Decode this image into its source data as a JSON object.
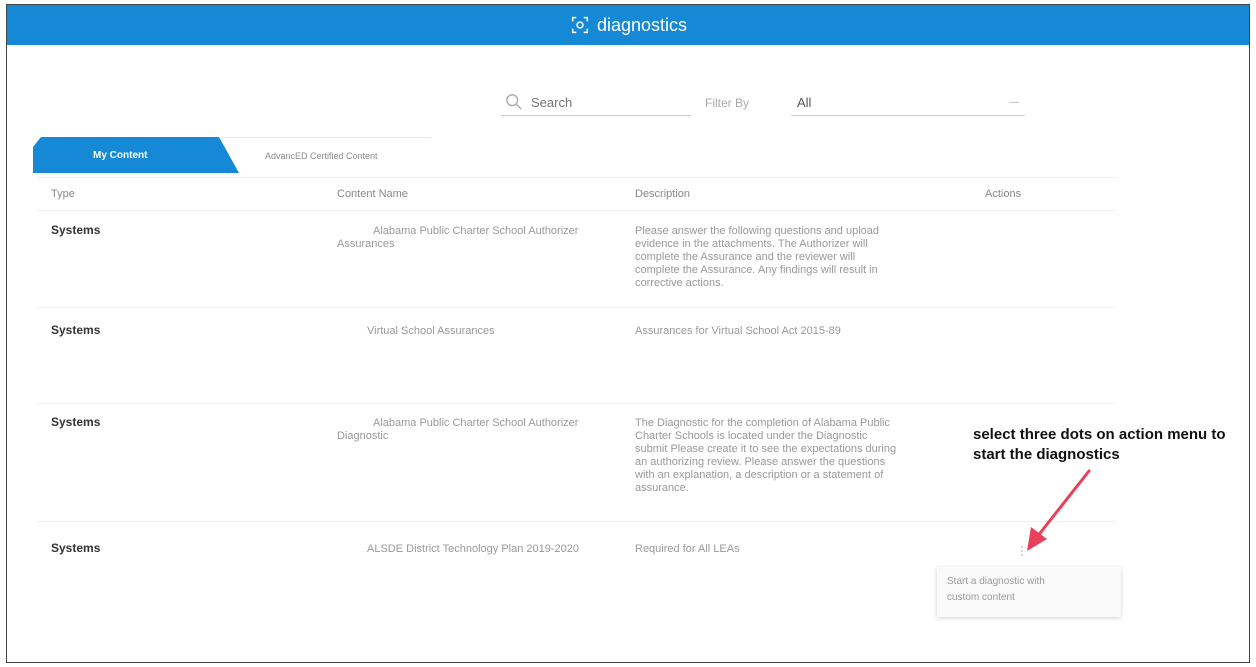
{
  "header": {
    "title": "diagnostics",
    "icon": "target-scan-icon",
    "color": "#1689d6"
  },
  "filters": {
    "search_placeholder": "Search",
    "filter_label": "Filter By",
    "filter_value": "All"
  },
  "tabs": [
    {
      "label": "My Content",
      "active": true
    },
    {
      "label": "AdvancED Certified Content",
      "active": false
    }
  ],
  "table": {
    "headers": [
      "Type",
      "Content Name",
      "Description",
      "Actions"
    ],
    "rows": [
      {
        "type": "Systems",
        "name": "Alabama Public Charter School Authorizer Assurances",
        "description": "Please answer the following questions and upload evidence in the attachments. The Authorizer will complete the Assurance and the reviewer will complete the Assurance. Any findings will result in corrective actions."
      },
      {
        "type": "Systems",
        "name": "Virtual School Assurances",
        "description": "Assurances for Virtual School Act 2015-89"
      },
      {
        "type": "Systems",
        "name": "Alabama Public Charter School Authorizer Diagnostic",
        "description": "The Diagnostic for the completion of Alabama Public Charter Schools is located under the Diagnostic submit Please create it to see the expectations during an authorizing review. Please answer the questions with an explanation, a description or a statement of assurance."
      },
      {
        "type": "Systems",
        "name": "ALSDE District Technology Plan 2019-2020",
        "description": "Required for All LEAs"
      }
    ]
  },
  "annotation": {
    "text": "select three dots on action menu to start the diagnostics",
    "arrow_color": "#e8405a"
  },
  "popup": {
    "line1": "Start a diagnostic with",
    "line2": "custom content"
  }
}
